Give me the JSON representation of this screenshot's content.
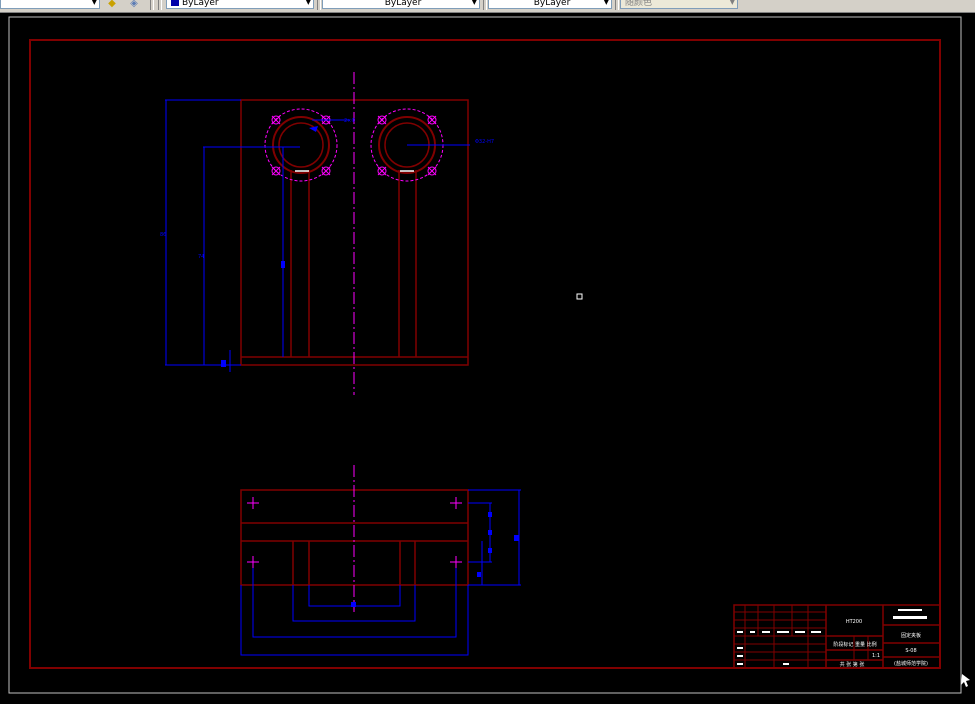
{
  "toolbar": {
    "layer_dropdown": {
      "value": ""
    },
    "color_dropdown": {
      "value": "ByLayer"
    },
    "linetype_dropdown": {
      "value": "ByLayer"
    },
    "lineweight_dropdown": {
      "value": "ByLayer"
    },
    "plotstyle_dropdown": {
      "value": "随颜色"
    },
    "icons": [
      "layer-manager-icon",
      "layer-states-icon"
    ]
  },
  "drawing": {
    "background": "#000000",
    "border_color": "#800000",
    "dimension_color": "#0000ff",
    "centerline_color": "#ff00ff",
    "frame_color": "#ffffff"
  },
  "title_block": {
    "material_label": "HT200",
    "company": "XXXXXXXX",
    "part_name": "固定夹板",
    "scale_labels": "阶段标记 重量 比例",
    "scale_value": "1:1",
    "sheet_label": "共 张 第 张",
    "drawing_no": "S-08",
    "school": "(盐城师范学院)"
  }
}
